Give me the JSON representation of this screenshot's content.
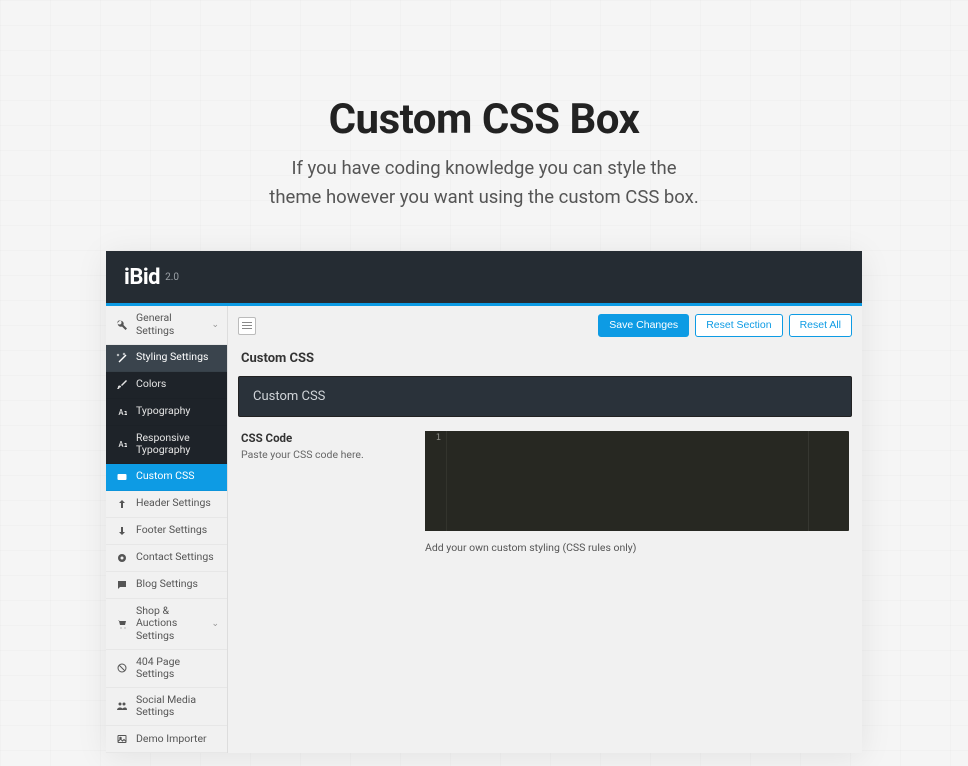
{
  "hero": {
    "title": "Custom CSS Box",
    "subtitle_l1": "If you have coding knowledge you can style the",
    "subtitle_l2": "theme however you want using the custom CSS box."
  },
  "brand": {
    "name": "iBid",
    "version": "2.0"
  },
  "toolbar": {
    "save": "Save Changes",
    "reset_section": "Reset Section",
    "reset_all": "Reset All"
  },
  "sidebar": {
    "items": [
      {
        "label": "General Settings",
        "variant": "light",
        "expandable": true
      },
      {
        "label": "Styling Settings",
        "variant": "dark-sel"
      },
      {
        "label": "Colors",
        "variant": "dark"
      },
      {
        "label": "Typography",
        "variant": "dark"
      },
      {
        "label": "Responsive Typography",
        "variant": "dark"
      },
      {
        "label": "Custom CSS",
        "variant": "active"
      },
      {
        "label": "Header Settings",
        "variant": "light"
      },
      {
        "label": "Footer Settings",
        "variant": "light"
      },
      {
        "label": "Contact Settings",
        "variant": "light"
      },
      {
        "label": "Blog Settings",
        "variant": "light"
      },
      {
        "label": "Shop & Auctions Settings",
        "variant": "light",
        "expandable": true
      },
      {
        "label": "404 Page Settings",
        "variant": "light"
      },
      {
        "label": "Social Media Settings",
        "variant": "light"
      },
      {
        "label": "Demo Importer",
        "variant": "light"
      }
    ]
  },
  "page": {
    "heading": "Custom CSS",
    "block_title": "Custom CSS",
    "field_label": "CSS Code",
    "field_desc": "Paste your CSS code here.",
    "gutter_line": "1",
    "code_help": "Add your own custom styling (CSS rules only)"
  }
}
